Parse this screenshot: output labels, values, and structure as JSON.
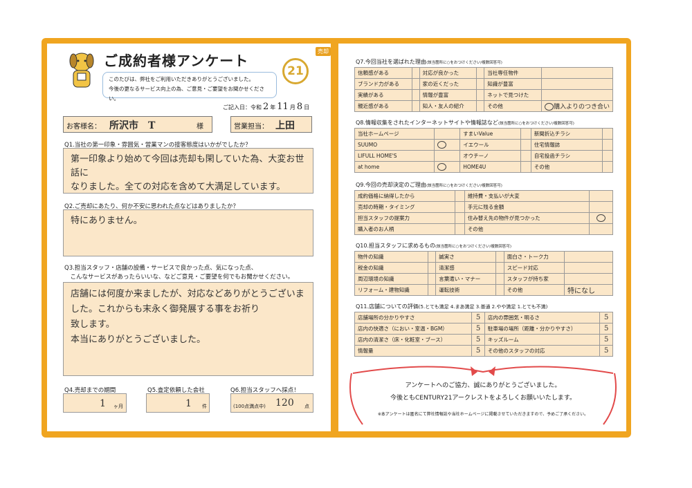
{
  "header": {
    "title": "ご成約者様アンケート",
    "badge": "売却",
    "logo": "21",
    "greeting1": "このたびは、弊社をご利用いただきありがとうございました。",
    "greeting2": "今後の更なるサービス向上の為、ご意見・ご要望をお聞かせください。",
    "date_label": "ご記入日：令和",
    "date_year": "2",
    "date_y": "年",
    "date_month": "11",
    "date_m": "月",
    "date_day": "8",
    "date_d": "日"
  },
  "customer": {
    "label": "お客様名：",
    "name": "所沢市　T",
    "sama": "様",
    "staff_label": "営業担当：",
    "staff": "上田"
  },
  "q1": {
    "question": "Q1.当社の第一印象・雰囲気・営業マンの接客態度はいかがでしたか？",
    "answer1": "第一印象より始めて今回は売却も閑していた為、大変お世話に",
    "answer2": "なりました。全ての対応を含めて大満足しています。"
  },
  "q2": {
    "question": "Q2.ご売却にあたり、何か不安に思われた点などはありましたか？",
    "answer": "特にありません。"
  },
  "q3": {
    "question1": "Q3.担当スタッフ・店舗の設備・サービスで良かった点、気になった点、",
    "question2": "　こんなサービスがあったらいいな、などご意見・ご要望を何でもお聞かせください。",
    "answer1": "店舗には何度か来ましたが、対応などありがとうございま",
    "answer2": "した。これからも末永く御発展する事をお祈り",
    "answer3": "致します。",
    "answer4": "本当にありがとうございました。"
  },
  "q4": {
    "question": "Q4.売却までの期間",
    "value": "1",
    "unit": "ヶ月"
  },
  "q5": {
    "question": "Q5.査定依頼した会社",
    "value": "1",
    "unit": "件"
  },
  "q6": {
    "question": "Q6.担当スタッフへ採点！",
    "sub": "(100点満点中)",
    "value": "120",
    "unit": "点"
  },
  "q7": {
    "question": "Q7.今回当社を選ばれた理由",
    "note": "(該当箇所に○をおつけください/複数回答可)",
    "rows": [
      [
        "信頼感がある",
        "対応が良かった",
        "当社専任物件"
      ],
      [
        "ブランド力がある",
        "家の近くだった",
        "知識が豊富"
      ],
      [
        "実績がある",
        "情報が豊富",
        "ネットで見つけた"
      ],
      [
        "親近感がある",
        "知人・友人の紹介",
        "その他"
      ]
    ],
    "other": "購入よりのつき合い"
  },
  "q8": {
    "question": "Q8.情報収集をされたインターネットサイトや情報誌など",
    "note": "(該当箇所に○をおつけください/複数回答可)",
    "rows": [
      [
        "当社ホームページ",
        "すまいValue",
        "新聞折込チラシ"
      ],
      [
        "SUUMO",
        "イエウール",
        "住宅情報誌"
      ],
      [
        "LIFULL HOME'S",
        "オウチーノ",
        "自宅投函チラシ"
      ],
      [
        "at home",
        "HOME4U",
        "その他"
      ]
    ]
  },
  "q9": {
    "question": "Q9.今回の売却決定のご理由",
    "note": "(該当箇所に○をおつけください/複数回答可)",
    "rows": [
      [
        "成約価格に納得したから",
        "維持費・支払いが大変"
      ],
      [
        "売却の時期・タイミング",
        "手元に残る金額"
      ],
      [
        "担当スタッフの提案力",
        "住み替え先の物件が見つかった"
      ],
      [
        "購入者のお人柄",
        "その他"
      ]
    ]
  },
  "q10": {
    "question": "Q10.担当スタッフに求めるもの",
    "note": "(該当箇所に○をおつけください/複数回答可)",
    "rows": [
      [
        "物件の知識",
        "誠実さ",
        "面白さ・トーク力"
      ],
      [
        "税金の知識",
        "清潔感",
        "スピード対応"
      ],
      [
        "周辺環境の知識",
        "言葉遣い・マナー",
        "スタッフが持ち家"
      ],
      [
        "リフォーム・建物知識",
        "運転技術",
        "その他"
      ]
    ],
    "other": "特になし"
  },
  "q11": {
    "question": "Q11.店舗についての評価",
    "scale": "(5.とても満足 4.まあ満足 3.普通 2.やや満足 1.とても不満)",
    "rows": [
      [
        "店舗場所の分かりやすさ",
        "5",
        "店内の雰囲気・明るさ",
        "5"
      ],
      [
        "店内の快適さ（におい・室温・BGM）",
        "5",
        "駐車場の場所（距離・分かりやすさ）",
        "5"
      ],
      [
        "店内の清潔さ（床・化粧室・ブース）",
        "5",
        "キッズルーム",
        "5"
      ],
      [
        "情報量",
        "5",
        "その他のスタッフの対応",
        "5"
      ]
    ]
  },
  "footer": {
    "line1": "アンケートへのご協力、誠にありがとうございました。",
    "line2": "今後ともCENTURY21アークレストをよろしくお願いいたします。",
    "note": "※本アンケートは匿名にて弊社情報誌や当社ホームページに掲載させていただきますので、予めご了承ください。"
  }
}
